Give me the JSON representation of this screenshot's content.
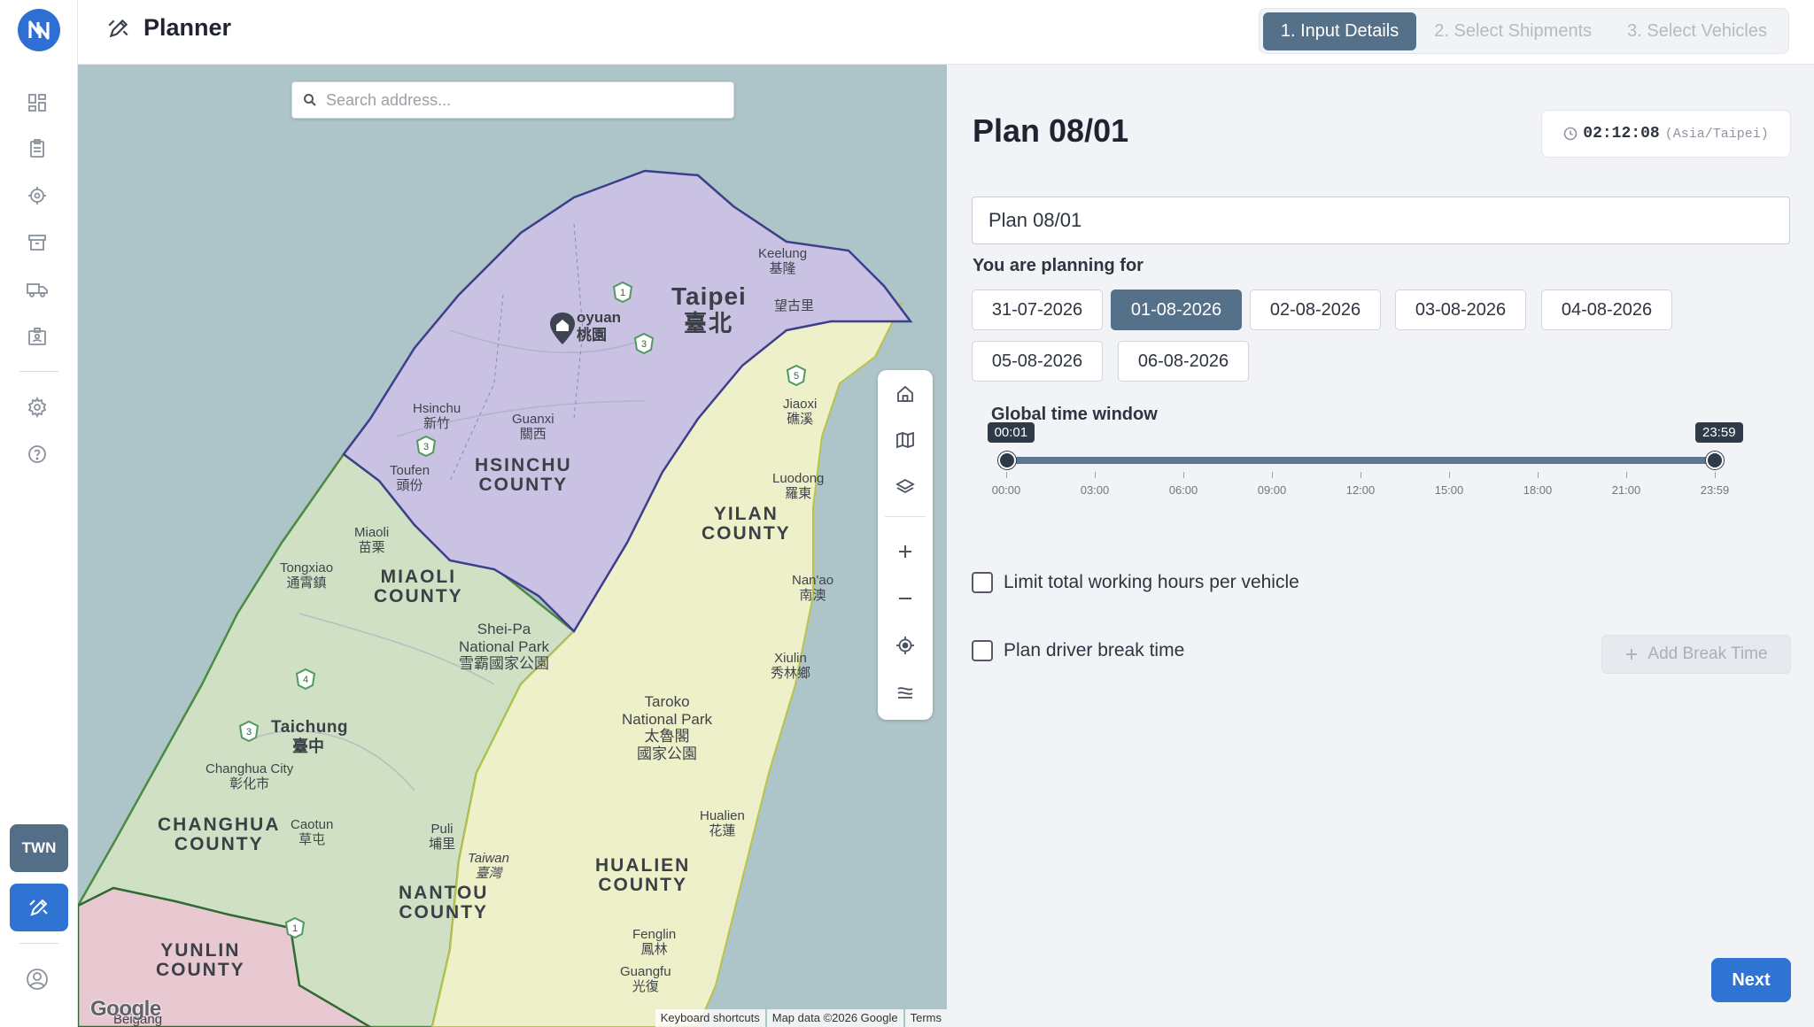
{
  "app": {
    "title": "Planner",
    "region_badge": "TWN"
  },
  "sidebar": {
    "items": [
      {
        "name": "dashboard-icon"
      },
      {
        "name": "clipboard-icon"
      },
      {
        "name": "target-icon"
      },
      {
        "name": "archive-icon"
      },
      {
        "name": "truck-icon"
      },
      {
        "name": "id-badge-icon"
      },
      {
        "name": "gear-icon"
      },
      {
        "name": "help-icon"
      }
    ]
  },
  "steps": [
    {
      "label": "1. Input Details",
      "active": true
    },
    {
      "label": "2. Select Shipments",
      "active": false
    },
    {
      "label": "3. Select Vehicles",
      "active": false
    }
  ],
  "map": {
    "search_placeholder": "Search address...",
    "footer": [
      "Keyboard shortcuts",
      "Map data ©2026 Google",
      "Terms"
    ],
    "google_logo": "Google",
    "labels": {
      "taipei": "Taipei",
      "taipei_zh": "臺北",
      "hsinchu_county": "HSINCHU\nCOUNTY",
      "yilan_county": "YILAN\nCOUNTY",
      "miaoli_county": "MIAOLI\nCOUNTY",
      "changhua_county": "CHANGHUA\nCOUNTY",
      "nantou_county": "NANTOU\nCOUNTY",
      "hualien_county": "HUALIEN\nCOUNTY",
      "yunlin_county": "YUNLIN\nCOUNTY",
      "taichung": "Taichung",
      "taichung_zh": "臺中",
      "taoyuan": "oyuan",
      "taoyuan_zh": "桃園",
      "keelung": "Keelung\n基隆",
      "wanglitai": "望古里",
      "hsinchu": "Hsinchu\n新竹",
      "guanxi": "Guanxi\n關西",
      "toufen": "Toufen\n頭份",
      "jiaoxi": "Jiaoxi\n礁溪",
      "luodong": "Luodong\n羅東",
      "miaoli": "Miaoli\n苗栗",
      "tongxiao": "Tongxiao\n通霄鎮",
      "sheipa": "Shei-Pa\nNational Park\n雪霸國家公園",
      "nanao": "Nan'ao\n南澳",
      "xiulin": "Xiulin\n秀林鄉",
      "taroko": "Taroko\nNational Park\n太魯閣\n國家公園",
      "changhua_city": "Changhua City\n彰化市",
      "caotun": "Caotun\n草屯",
      "puli": "Puli\n埔里",
      "taiwan": "Taiwan\n臺灣",
      "hualien": "Hualien\n花蓮",
      "fenglin": "Fenglin\n鳳林",
      "guangfu": "Guangfu\n光復",
      "beigang": "Beigang"
    },
    "route_shields": [
      "1",
      "3",
      "5",
      "3",
      "4",
      "3",
      "1"
    ]
  },
  "plan": {
    "heading": "Plan 08/01",
    "clock_time": "02:12:08",
    "clock_tz": "(Asia/Taipei)",
    "name_value": "Plan 08/01",
    "planning_label": "You are planning for",
    "dates": [
      "31-07-2026",
      "01-08-2026",
      "02-08-2026",
      "03-08-2026",
      "04-08-2026",
      "05-08-2026",
      "06-08-2026"
    ],
    "selected_date": "01-08-2026",
    "time_window_label": "Global time window",
    "time_window": {
      "start": "00:01",
      "end": "23:59",
      "start_minutes": 1,
      "end_minutes": 1439,
      "ticks": [
        "00:00",
        "03:00",
        "06:00",
        "09:00",
        "12:00",
        "15:00",
        "18:00",
        "21:00",
        "23:59"
      ]
    },
    "limit_hours_label": "Limit total working hours per vehicle",
    "limit_hours_checked": false,
    "break_time_label": "Plan driver break time",
    "break_time_checked": false,
    "add_break_label": "Add Break Time",
    "next_label": "Next"
  },
  "colors": {
    "accent": "#2f74d3",
    "step_active": "#557089",
    "region_taipei": "#c9c2e3",
    "region_yilan": "#eef0c9",
    "region_central": "#cfe0c4",
    "region_yunlin": "#e8c8d1"
  }
}
